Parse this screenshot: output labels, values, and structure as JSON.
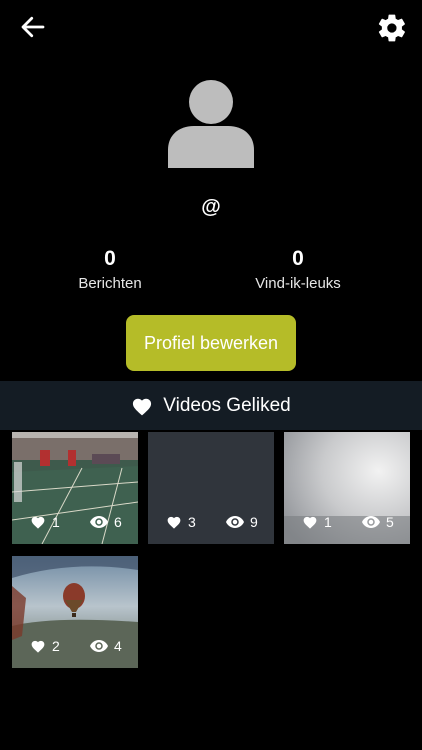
{
  "profile": {
    "handle": "@",
    "stats": {
      "posts_count": "0",
      "posts_label": "Berichten",
      "likes_count": "0",
      "likes_label": "Vind-ik-leuks"
    },
    "edit_button": "Profiel bewerken"
  },
  "tab": {
    "label": "Videos Geliked",
    "icon": "heart-icon"
  },
  "videos": [
    {
      "likes": "1",
      "views": "6",
      "thumbnail": "sports-hall"
    },
    {
      "likes": "3",
      "views": "9",
      "thumbnail": "dark-gray"
    },
    {
      "likes": "1",
      "views": "5",
      "thumbnail": "bright-sky"
    },
    {
      "likes": "2",
      "views": "4",
      "thumbnail": "hot-air-balloon"
    }
  ],
  "colors": {
    "accent": "#b5bc28",
    "tab_bg": "#141c24",
    "background": "#000000"
  }
}
